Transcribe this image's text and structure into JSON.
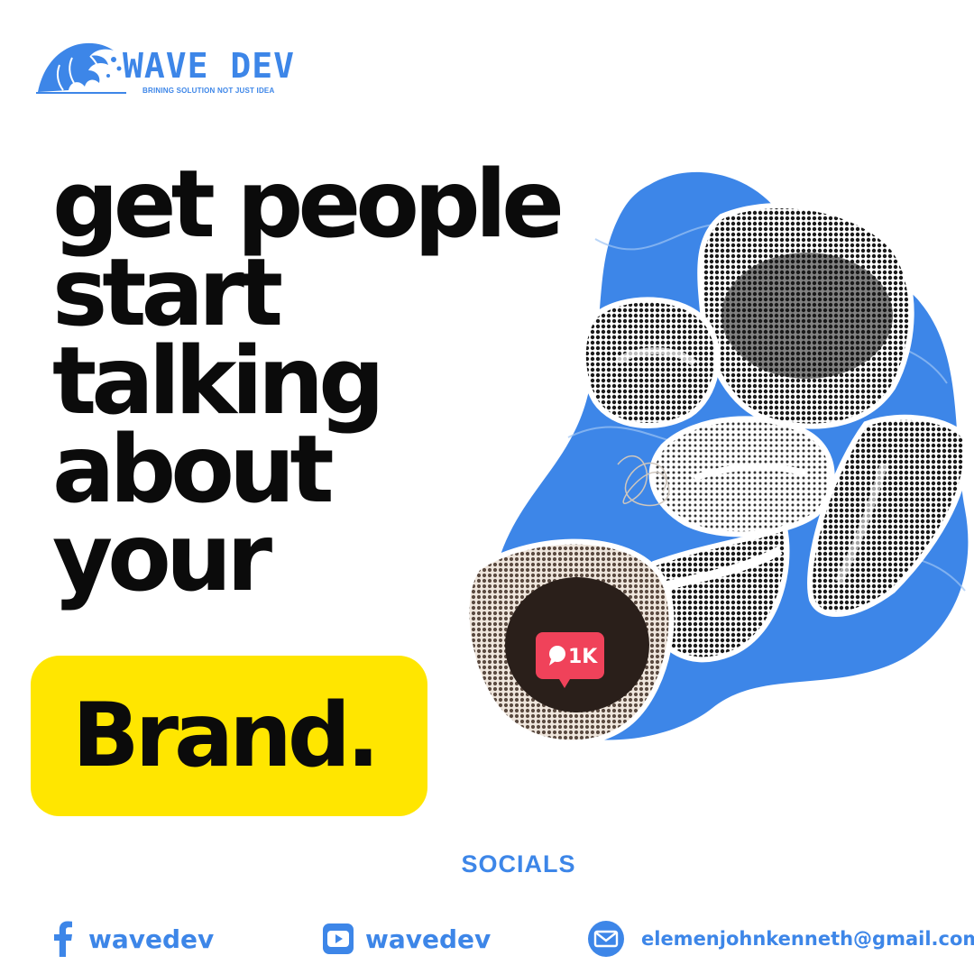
{
  "brand": {
    "name": "WAVE DEV",
    "tagline": "BRINING SOLUTION NOT JUST IDEA"
  },
  "headline": {
    "lines": [
      "get people",
      "start",
      "talking",
      "about",
      "your"
    ],
    "highlight": "Brand."
  },
  "collage": {
    "notification_badge": "1K",
    "icon": "comment-bubble-icon"
  },
  "socials": {
    "title": "SOCIALS",
    "facebook": {
      "icon": "facebook-icon",
      "label": "wavedev"
    },
    "youtube": {
      "icon": "youtube-icon",
      "label": "wavedev"
    },
    "email": {
      "icon": "email-icon",
      "label": "elemenjohnkenneth@gmail.com"
    }
  },
  "colors": {
    "accent": "#3d86e8",
    "highlight": "#ffe600",
    "text": "#0b0b0b",
    "badge": "#f0425a"
  }
}
